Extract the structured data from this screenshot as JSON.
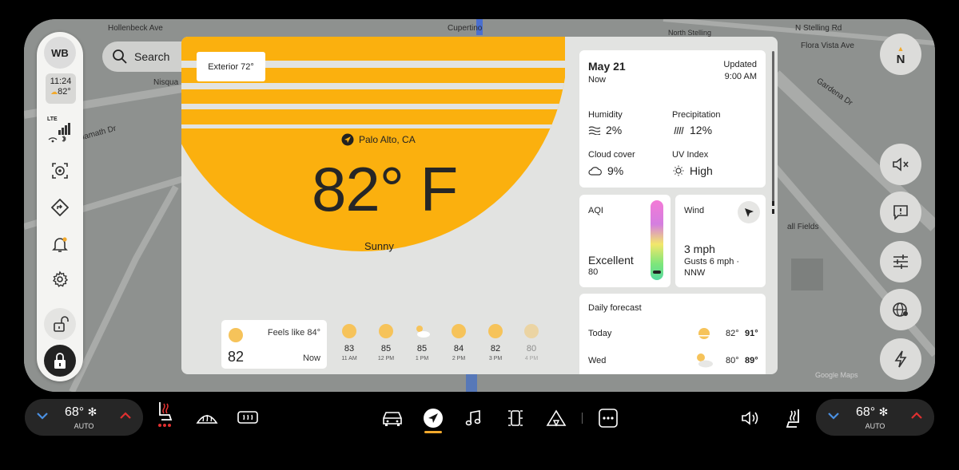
{
  "map": {
    "streets": [
      "Hollenbeck Ave",
      "Cupertino",
      "North Stelling",
      "N Stelling Rd",
      "Flora Vista Ave",
      "Gardena Dr",
      "Nisqua",
      "Klamath Dr",
      "all Fields"
    ],
    "attribution": "Google Maps"
  },
  "rail": {
    "avatar": "WB",
    "time": "11:24",
    "weather_temp": "82°",
    "network": "LTE",
    "icons": [
      "camera-icon",
      "navigation-diamond-icon",
      "bell-icon",
      "gear-icon",
      "unlock-icon",
      "lock-icon"
    ]
  },
  "search": {
    "label": "Search"
  },
  "compass": {
    "label": "N"
  },
  "weather": {
    "exterior": "Exterior 72°",
    "location": "Palo Alto, CA",
    "temperature": "82° F",
    "condition": "Sunny",
    "now": {
      "feels_like": "Feels like 84°",
      "temp": "82",
      "label": "Now"
    },
    "hourly": [
      {
        "temp": "83",
        "time": "11 AM",
        "icon": "sun"
      },
      {
        "temp": "85",
        "time": "12 PM",
        "icon": "sun"
      },
      {
        "temp": "85",
        "time": "1 PM",
        "icon": "partly-cloudy"
      },
      {
        "temp": "84",
        "time": "2 PM",
        "icon": "sun"
      },
      {
        "temp": "82",
        "time": "3 PM",
        "icon": "sun"
      },
      {
        "temp": "80",
        "time": "4 PM",
        "icon": "sun"
      }
    ],
    "date": "May 21",
    "date_sub": "Now",
    "updated": "Updated",
    "updated_time": "9:00 AM",
    "humidity_label": "Humidity",
    "humidity": "2%",
    "precip_label": "Precipitation",
    "precip": "12%",
    "cloud_label": "Cloud cover",
    "cloud": "9%",
    "uv_label": "UV Index",
    "uv": "High",
    "aqi_label": "AQI",
    "aqi_text": "Excellent",
    "aqi_value": "80",
    "wind_label": "Wind",
    "wind_speed": "3 mph",
    "wind_gusts": "Gusts 6 mph ·",
    "wind_dir": "NNW",
    "daily_label": "Daily forecast",
    "daily": [
      {
        "day": "Today",
        "low": "82°",
        "high": "91°",
        "icon": "sun"
      },
      {
        "day": "Wed",
        "low": "80°",
        "high": "89°",
        "icon": "partly-cloudy"
      }
    ]
  },
  "climate_left": {
    "temp": "68°",
    "mode": "AUTO"
  },
  "climate_right": {
    "temp": "68°",
    "mode": "AUTO"
  },
  "colors": {
    "sun": "#fbb00e",
    "accent": "#f2a92c",
    "blue": "#4a90e2",
    "red": "#e03030"
  }
}
